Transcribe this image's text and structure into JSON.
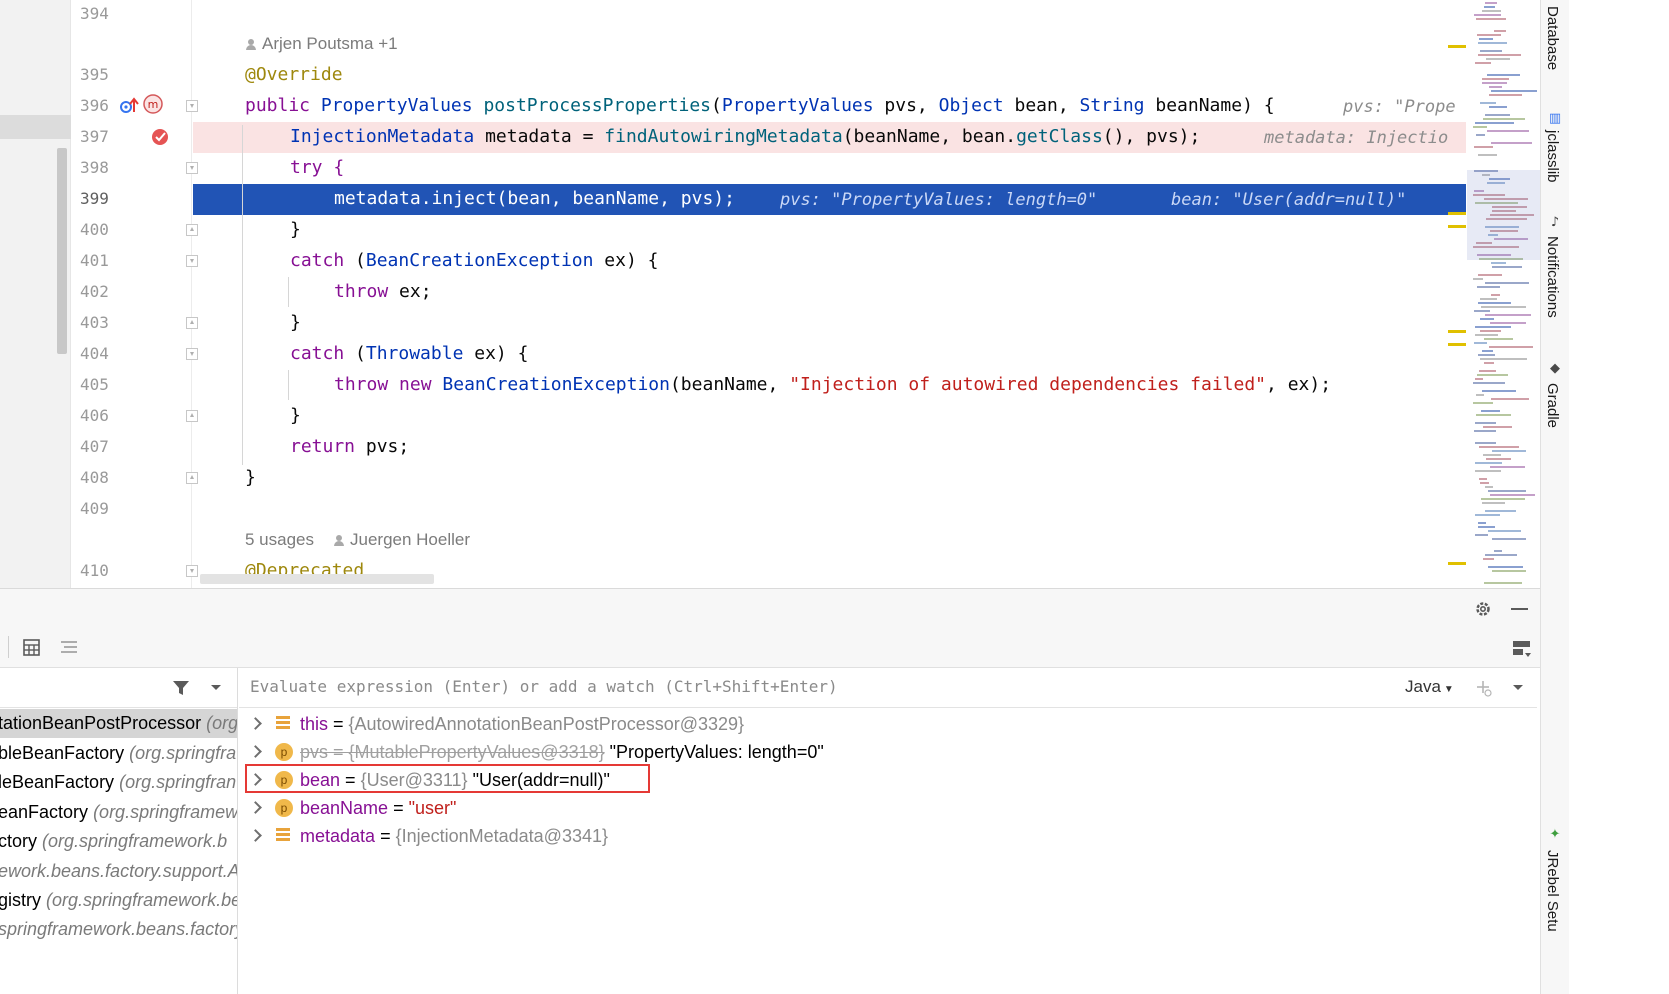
{
  "editor": {
    "line_numbers": [
      "394",
      "395",
      "396",
      "397",
      "398",
      "399",
      "400",
      "401",
      "402",
      "403",
      "404",
      "405",
      "406",
      "407",
      "408",
      "409",
      "410"
    ],
    "authors_hint_1": "Arjen Poutsma +1",
    "usages_hint": "5 usages",
    "authors_hint_2": "Juergen Hoeller",
    "code": {
      "l395": "@Override",
      "l396_public": "public",
      "l396_type": "PropertyValues",
      "l396_method": "postProcessProperties",
      "l396_params_1": "(",
      "l396_ptype1": "PropertyValues",
      "l396_p1": " pvs, ",
      "l396_ptype2": "Object",
      "l396_p2": " bean, ",
      "l396_ptype3": "String",
      "l396_p3": " beanName) {",
      "l396_inline": "pvs: \"Prope",
      "l397_type": "InjectionMetadata",
      "l397_rest1": " metadata = ",
      "l397_call": "findAutowiringMetadata",
      "l397_rest2": "(beanName, bean.",
      "l397_call2": "getClass",
      "l397_rest3": "(), pvs);",
      "l397_inline": "metadata: Injectio",
      "l398": "try {",
      "l399": "metadata.inject(bean, beanName, pvs);",
      "l399_inline_1": "pvs: \"PropertyValues: length=0\"",
      "l399_inline_2": "bean: \"User(addr=null)\"",
      "l400": "}",
      "l401_catch": "catch",
      "l401_type": "BeanCreationException",
      "l401_rest": " ex) {",
      "l402_throw": "throw",
      "l402_rest": " ex;",
      "l403": "}",
      "l404_catch": "catch",
      "l404_type": "Throwable",
      "l404_rest": " ex) {",
      "l405_throw": "throw new",
      "l405_type": "BeanCreationException",
      "l405_rest1": "(beanName, ",
      "l405_str": "\"Injection of autowired dependencies failed\"",
      "l405_rest2": ", ex);",
      "l406": "}",
      "l407_return": "return",
      "l407_rest": " pvs;",
      "l408": "}",
      "l410": "@Deprecated"
    }
  },
  "right_tools": {
    "database": "Database",
    "jclasslib": "jclasslib",
    "notifications": "Notifications",
    "gradle": "Gradle",
    "jrebel": "JRebel Setu"
  },
  "debugger": {
    "eval_placeholder": "Evaluate expression (Enter) or add a watch (Ctrl+Shift+Enter)",
    "language": "Java",
    "frames": [
      {
        "method": "tationBeanPostProcessor",
        "pkg": "(org."
      },
      {
        "method": "bleBeanFactory",
        "pkg": "(org.springfra"
      },
      {
        "method": "leBeanFactory",
        "pkg": "(org.springfran"
      },
      {
        "method": "eanFactory",
        "pkg": "(org.springframew"
      },
      {
        "method": "ctory",
        "pkg": "(org.springframework.b"
      },
      {
        "method": "",
        "pkg": "ework.beans.factory.support.A"
      },
      {
        "method": "gistry",
        "pkg": "(org.springframework.be"
      },
      {
        "method": "",
        "pkg": "springframework.beans.factory"
      }
    ],
    "variables": [
      {
        "name": "this",
        "eq": " = ",
        "ref": "{AutowiredAnnotationBeanPostProcessor@3329}",
        "val": "",
        "kind": "field"
      },
      {
        "name": "pvs",
        "eq": " = ",
        "ref": "{MutablePropertyValues@3318}",
        "val": "\"PropertyValues: length=0\"",
        "kind": "param"
      },
      {
        "name": "bean",
        "eq": " = ",
        "ref": "{User@3311}",
        "val": "\"User(addr=null)\"",
        "kind": "param"
      },
      {
        "name": "beanName",
        "eq": " = ",
        "ref": "",
        "val": "\"user\"",
        "kind": "param"
      },
      {
        "name": "metadata",
        "eq": " = ",
        "ref": "{InjectionMetadata@3341}",
        "val": "",
        "kind": "field"
      }
    ],
    "param_badge": "p"
  }
}
